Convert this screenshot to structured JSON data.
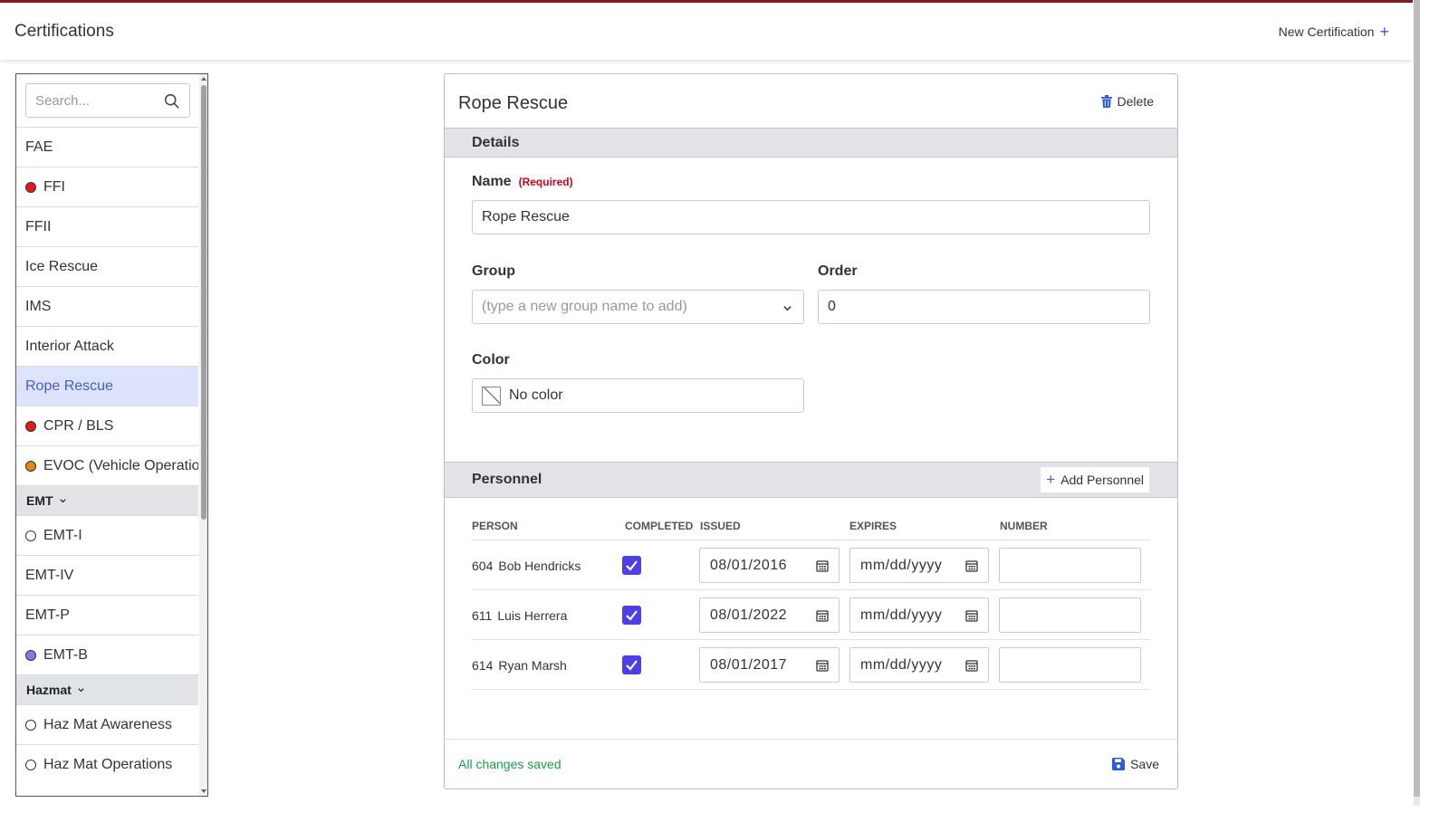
{
  "header": {
    "title": "Certifications",
    "new_label": "New Certification",
    "new_icon": "plus-icon"
  },
  "sidebar": {
    "search_placeholder": "Search...",
    "items": [
      {
        "label": "FAE",
        "dot": null
      },
      {
        "label": "FFI",
        "dot": "#e01b1b"
      },
      {
        "label": "FFII",
        "dot": null
      },
      {
        "label": "Ice Rescue",
        "dot": null
      },
      {
        "label": "IMS",
        "dot": null
      },
      {
        "label": "Interior Attack",
        "dot": null
      },
      {
        "label": "Rope Rescue",
        "dot": null,
        "active": true
      },
      {
        "label": "CPR / BLS",
        "dot": "#e01b1b"
      },
      {
        "label": "EVOC (Vehicle Operation",
        "dot": "#e08a10"
      }
    ],
    "groups": [
      {
        "name": "EMT",
        "items": [
          {
            "label": "EMT-I",
            "dot": "#ffffff"
          },
          {
            "label": "EMT-IV",
            "dot": null
          },
          {
            "label": "EMT-P",
            "dot": null
          },
          {
            "label": "EMT-B",
            "dot": "#7b7bf0"
          }
        ]
      },
      {
        "name": "Hazmat",
        "items": [
          {
            "label": "Haz Mat Awareness",
            "dot": "#ffffff"
          },
          {
            "label": "Haz Mat Operations",
            "dot": "#ffffff"
          }
        ]
      }
    ]
  },
  "detail": {
    "title": "Rope Rescue",
    "delete_label": "Delete",
    "details_section": "Details",
    "name_label": "Name",
    "required_label": "(Required)",
    "name_value": "Rope Rescue",
    "group_label": "Group",
    "group_placeholder": "(type a new group name to add)",
    "order_label": "Order",
    "order_value": "0",
    "color_label": "Color",
    "color_value": "No color",
    "personnel_section": "Personnel",
    "add_personnel_label": "Add Personnel",
    "columns": [
      "PERSON",
      "COMPLETED",
      "ISSUED",
      "EXPIRES",
      "NUMBER"
    ],
    "personnel": [
      {
        "number": "604",
        "name": "Bob Hendricks",
        "completed": true,
        "issued": "08/01/2016",
        "expires": "mm/dd/yyyy",
        "cert_number": ""
      },
      {
        "number": "611",
        "name": "Luis Herrera",
        "completed": true,
        "issued": "08/01/2022",
        "expires": "mm/dd/yyyy",
        "cert_number": ""
      },
      {
        "number": "614",
        "name": "Ryan Marsh",
        "completed": true,
        "issued": "08/01/2017",
        "expires": "mm/dd/yyyy",
        "cert_number": ""
      }
    ],
    "status": "All changes saved",
    "save_label": "Save"
  },
  "colors": {
    "accent": "#4c3fe6",
    "header_border": "#8b1a1a",
    "success": "#19a04a",
    "required": "#d0021b",
    "active_bg": "#dde3fb"
  }
}
